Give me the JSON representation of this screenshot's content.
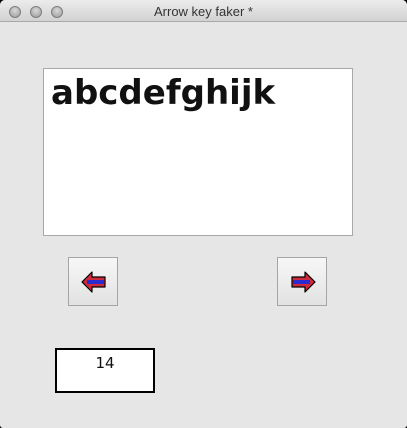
{
  "window": {
    "title": "Arrow key faker *"
  },
  "text_area": {
    "value": "abcdefghijk"
  },
  "buttons": {
    "left": {
      "icon": "left-arrow-icon"
    },
    "right": {
      "icon": "right-arrow-icon"
    }
  },
  "counter": {
    "value": "14"
  },
  "colors": {
    "arrow_fill": "#ce2a3c",
    "arrow_stripe": "#2a2ad0",
    "arrow_outline": "#000000"
  }
}
